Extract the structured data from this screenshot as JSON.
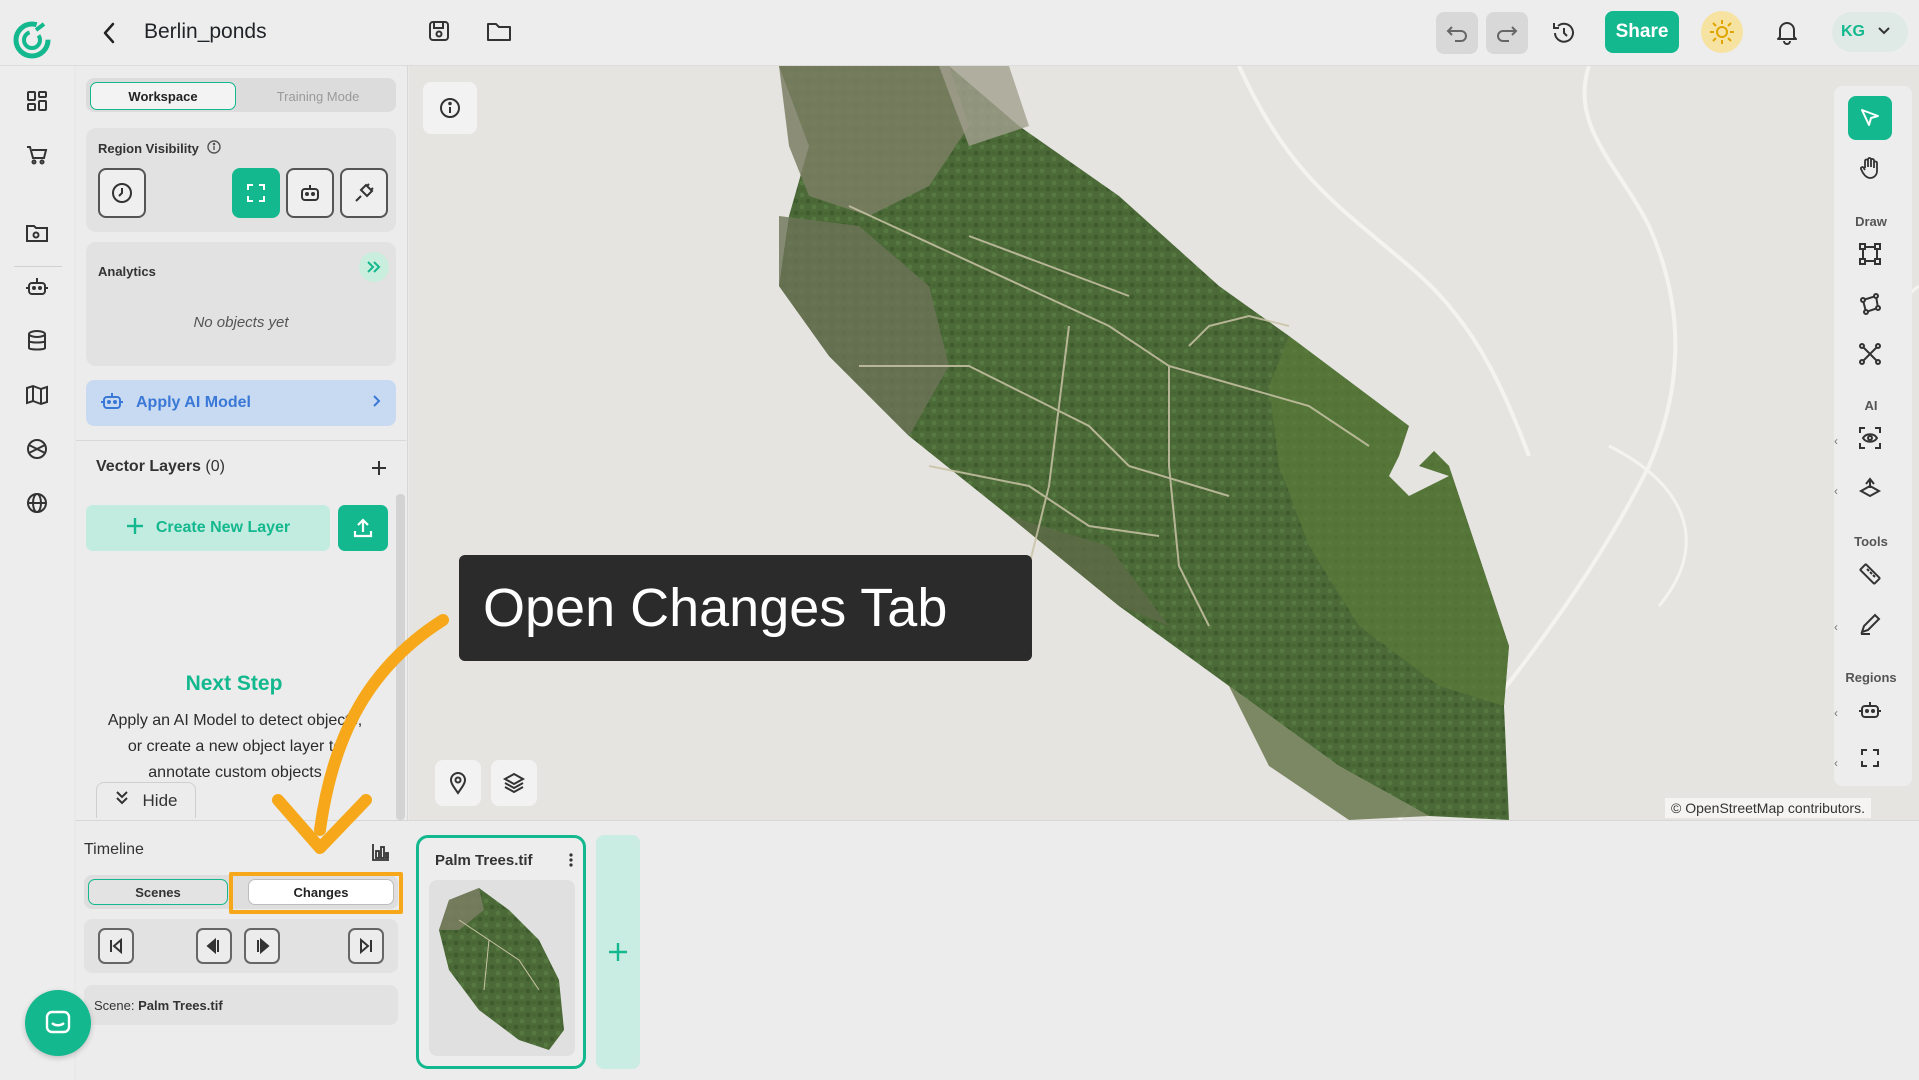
{
  "app": {
    "project_title": "Berlin_ponds",
    "share_label": "Share",
    "user_initials": "KG",
    "accent_color": "#14b88e",
    "highlight_color": "#f6a81a"
  },
  "left_panel": {
    "mode_tabs": [
      "Workspace",
      "Training Mode"
    ],
    "region_visibility_title": "Region Visibility",
    "analytics_title": "Analytics",
    "analytics_empty": "No objects yet",
    "apply_ai_label": "Apply AI Model",
    "vector_layers_title": "Vector Layers",
    "vector_layers_count": "(0)",
    "create_layer_label": "Create New Layer",
    "next_step_title": "Next Step",
    "next_step_body": "Apply an AI Model to detect objects, or create a new object layer to annotate custom objects",
    "hide_label": "Hide"
  },
  "map": {
    "attribution": "© OpenStreetMap contributors."
  },
  "right_toolbar": {
    "sections": [
      "Draw",
      "AI",
      "Tools",
      "Regions"
    ]
  },
  "tooltip": {
    "text": "Open Changes Tab"
  },
  "timeline": {
    "title": "Timeline",
    "tabs": [
      "Scenes",
      "Changes"
    ],
    "scene_label": "Scene:",
    "scene_value": "Palm Trees.tif",
    "scene_card_title": "Palm Trees.tif"
  },
  "icons": [
    "logo-icon",
    "back-icon",
    "save-icon",
    "folder-icon",
    "undo-icon",
    "redo-icon",
    "history-icon",
    "sun-icon",
    "bell-icon",
    "chevron-down-icon",
    "dashboard-icon",
    "cart-icon",
    "folder-image-icon",
    "robot-icon",
    "database-icon",
    "map-icon",
    "globe-icon",
    "info-icon",
    "pin-icon",
    "layers-icon",
    "cursor-icon",
    "hand-icon",
    "bbox-icon",
    "polygon-icon",
    "polyline-icon",
    "eye-scan-icon",
    "ai-layers-icon",
    "ruler-icon",
    "pen-icon",
    "expand-icon",
    "plus-icon",
    "upload-icon",
    "chat-icon"
  ]
}
